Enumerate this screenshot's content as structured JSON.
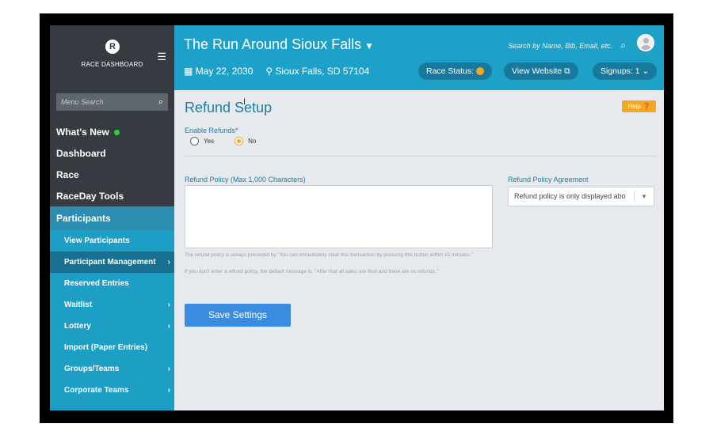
{
  "sidebar": {
    "logo_letter": "R",
    "brand": "RACE DASHBOARD",
    "search_placeholder": "Menu Search",
    "items": [
      {
        "label": "What's New"
      },
      {
        "label": "Dashboard"
      },
      {
        "label": "Race"
      },
      {
        "label": "RaceDay Tools"
      },
      {
        "label": "Participants"
      }
    ],
    "subitems": [
      {
        "label": "View Participants",
        "chevron": false
      },
      {
        "label": "Participant Management",
        "chevron": true
      },
      {
        "label": "Reserved Entries",
        "chevron": false
      },
      {
        "label": "Waitlist",
        "chevron": true
      },
      {
        "label": "Lottery",
        "chevron": true
      },
      {
        "label": "Import (Paper Entries)",
        "chevron": false
      },
      {
        "label": "Groups/Teams",
        "chevron": true
      },
      {
        "label": "Corporate Teams",
        "chevron": true
      }
    ]
  },
  "header": {
    "race_title": "The Run Around Sioux Falls",
    "date": "May 22, 2030",
    "location": "Sioux Falls, SD 57104",
    "search_placeholder": "Search by Name, Bib, Email, etc.",
    "race_status_label": "Race Status:",
    "view_website_label": "View Website",
    "signups_label": "Signups: 1"
  },
  "main": {
    "page_title": "Refund Setup",
    "help_label": "Help",
    "enable_label": "Enable Refunds*",
    "option_yes": "Yes",
    "option_no": "No",
    "selected": "No",
    "policy_label": "Refund Policy (Max 1,000 Characters)",
    "policy_value": "",
    "help_text_1": "The refund policy is always preceded by \"You can immediately clear this transaction by pressing this button within 15 minutes.\"",
    "help_text_2": "If you don't enter a refund policy, the default message is: \"After that all sales are final and there are no refunds.\"",
    "agreement_label": "Refund Policy Agreement",
    "agreement_value": "Refund policy is only displayed abo",
    "save_label": "Save Settings"
  },
  "colors": {
    "sidebar_bg": "#353b40",
    "header_bg": "#1ea1c9",
    "accent_orange": "#f5a623",
    "save_blue": "#3a8ce0"
  }
}
